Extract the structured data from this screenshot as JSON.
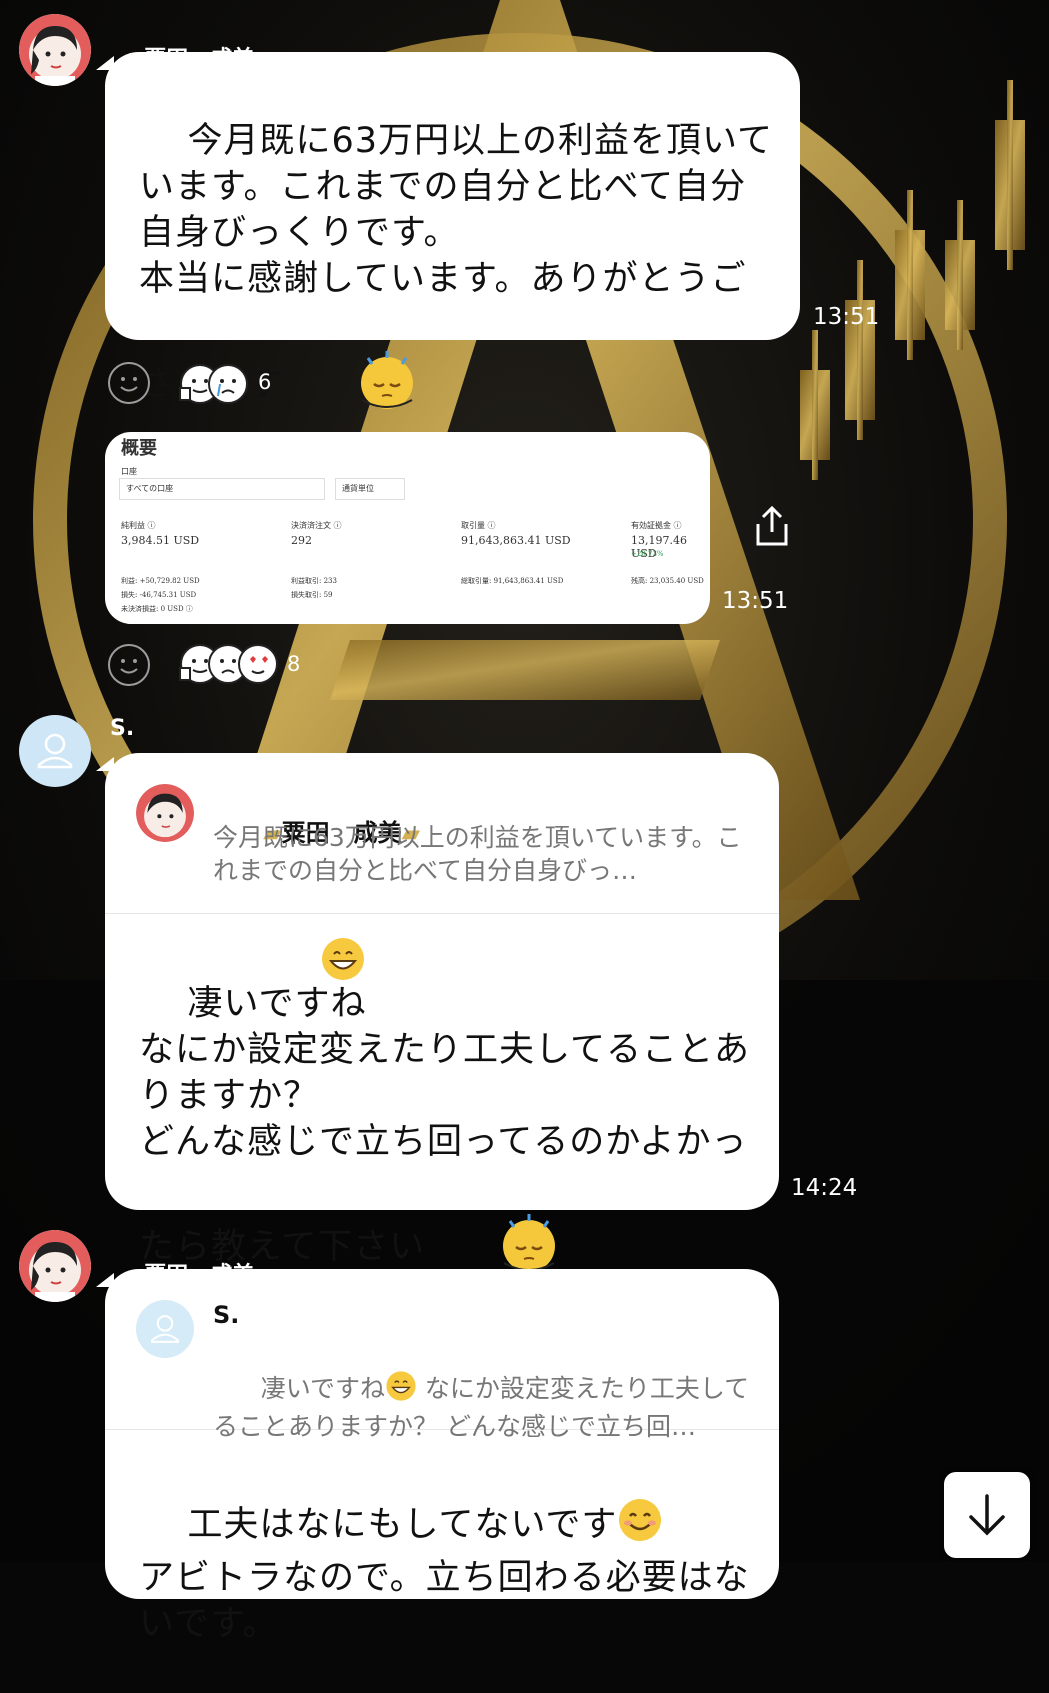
{
  "conversation": {
    "messages": [
      {
        "sender": "粟田　成美",
        "text": "今月既に63万円以上の利益を頂いています。これまでの自分と比べて自分自身びっくりです。\n本当に感謝しています。ありがとうございます",
        "time": "13:51",
        "reactions": {
          "count": "6",
          "icons": [
            "thumbs-up-face",
            "crying-face"
          ]
        }
      },
      {
        "type": "screenshot",
        "time": "13:51",
        "reactions": {
          "count": "8",
          "icons": [
            "thumbs-up-face",
            "crying-face",
            "heart-eyes-face"
          ]
        },
        "screenshot": {
          "title": "概要",
          "filter_label": "口座",
          "dropdown1": "すべての口座",
          "dropdown2": "通貨単位",
          "stats": [
            {
              "label": "純利益 ⓘ",
              "value": "3,984.51 USD"
            },
            {
              "label": "決済済注文 ⓘ",
              "value": "292"
            },
            {
              "label": "取引量 ⓘ",
              "value": "91,643,863.41 USD"
            },
            {
              "label": "有効証拠金 ⓘ",
              "value": "13,197.46 USD",
              "sub": "+20.73%"
            }
          ],
          "details": [
            "利益: +50,729.82 USD",
            "損失: -46,745.31 USD",
            "未決済損益: 0 USD ⓘ",
            "利益取引: 233",
            "損失取引: 59",
            "総取引量: 91,643,863.41 USD",
            "残高: 23,035.40 USD"
          ]
        }
      },
      {
        "sender": "S.",
        "reply_to": {
          "name": "粟田　成美",
          "snippet": "今月既に63万円以上の利益を頂いています。これまでの自分と比べて自分自身びっ…"
        },
        "text": "凄いですね\nなにか設定変えたり工夫してることありますか？\nどんな感じで立ち回ってるのかよかったら教えて下さい",
        "time": "14:24"
      },
      {
        "sender": "粟田　成美",
        "reply_to": {
          "name": "S.",
          "snippet_pre": "凄いですね",
          "snippet_post": " なにか設定変えたり工夫してることありますか？ どんな感じで立ち回…"
        },
        "text_line1": "工夫はなにもしてないです",
        "text_line2": "アビトラなので。立ち回わる必要はないです。"
      }
    ]
  },
  "colors": {
    "accent_gold": "#c9a445",
    "bubble": "#ffffff",
    "background": "#070707"
  },
  "icons": {
    "share": "share-icon",
    "scroll_down": "arrow-down-icon",
    "reaction_add": "smile-icon"
  }
}
